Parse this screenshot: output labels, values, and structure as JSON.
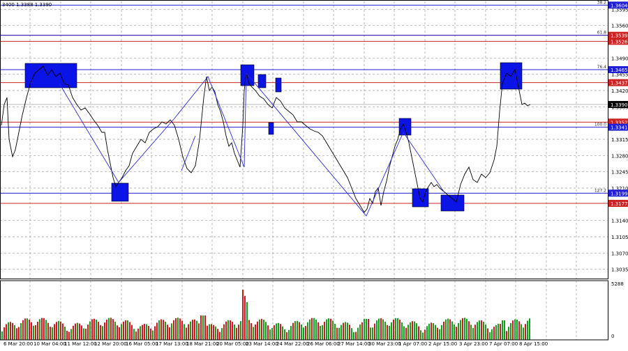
{
  "header": {
    "ohlc_text": "3400 1.3388 1.3390"
  },
  "levels": [
    {
      "price": 1.3604,
      "label": "1.3604",
      "color": "#1f1fd6",
      "fib": "38.2"
    },
    {
      "price": 1.3539,
      "label": "1.3539",
      "color": "#cc2222",
      "fib": ""
    },
    {
      "price": 1.3526,
      "label": "1.3526",
      "color": "#cc2222",
      "fib": ""
    },
    {
      "price": 1.3539,
      "label": "",
      "color": "#1f1fd6",
      "fib": "61.8"
    },
    {
      "price": 1.3465,
      "label": "1.3465",
      "color": "#1f1fd6",
      "fib": "76.4"
    },
    {
      "price": 1.3437,
      "label": "1.3437",
      "color": "#cc2222",
      "fib": ""
    },
    {
      "price": 1.3352,
      "label": "1.3352",
      "color": "#cc2222",
      "fib": ""
    },
    {
      "price": 1.3341,
      "label": "1.3341",
      "color": "#1f1fd6",
      "fib": "100.0"
    },
    {
      "price": 1.3199,
      "label": "1.3199",
      "color": "#1f1fd6",
      "fib": "127.2"
    },
    {
      "price": 1.3177,
      "label": "1.3177",
      "color": "#cc2222",
      "fib": ""
    }
  ],
  "current_price": {
    "price": 1.339,
    "label": "1.3390"
  },
  "price_axis": {
    "ticks": [
      {
        "v": 1.3595,
        "label": "1.3595"
      },
      {
        "v": 1.356,
        "label": "1.3560"
      },
      {
        "v": 1.349,
        "label": "1.3490"
      },
      {
        "v": 1.3455,
        "label": "1.3455"
      },
      {
        "v": 1.342,
        "label": "1.3420"
      },
      {
        "v": 1.3385,
        "label": "1.3385"
      },
      {
        "v": 1.3315,
        "label": "1.3315"
      },
      {
        "v": 1.328,
        "label": "1.3280"
      },
      {
        "v": 1.3245,
        "label": "1.3245"
      },
      {
        "v": 1.321,
        "label": "1.3210"
      },
      {
        "v": 1.314,
        "label": "1.3140"
      },
      {
        "v": 1.3105,
        "label": "1.3105"
      },
      {
        "v": 1.307,
        "label": "1.3070"
      },
      {
        "v": 1.3035,
        "label": "1.3035"
      }
    ]
  },
  "volume_axis": {
    "max_label": "5288",
    "min_label": "0"
  },
  "time_axis": {
    "labels": [
      "6 Mar 20:00",
      "10 Mar 04:00",
      "11 Mar 12:00",
      "12 Mar 20:00",
      "16 Mar 05:00",
      "17 Mar 13:00",
      "18 Mar 21:00",
      "20 Mar 05:00",
      "23 Mar 14:00",
      "24 Mar 22:00",
      "26 Mar 06:00",
      "27 Mar 14:00",
      "30 Mar 23:00",
      "1 Apr 07:00",
      "2 Apr 15:00",
      "3 Apr 23:00",
      "7 Apr 07:00",
      "8 Apr 15:00"
    ]
  },
  "colors": {
    "bull": "#1a9c1a",
    "bear": "#cc1a1a",
    "zone": "#0a14e6",
    "price_line": "#000000",
    "grid": "#9a9a9a"
  }
}
